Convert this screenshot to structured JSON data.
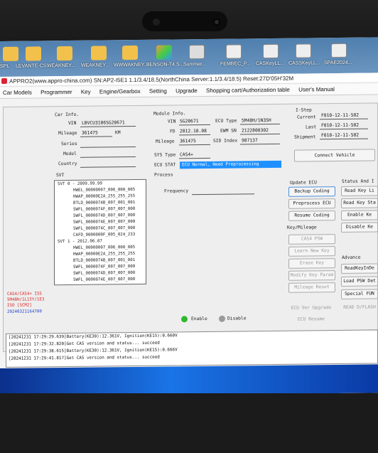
{
  "taskbar": {
    "items": [
      "SPL",
      "LEVANTE-CS...",
      "WEAKNEY...",
      "WEAKNEY...",
      "WWWAKNEY...",
      "BENSON-T4.S...",
      "Summer...",
      "FEMBEC_P...",
      "CASKeyLL...",
      "CASSKeyLL...",
      "SPAE2024..."
    ]
  },
  "title_bar": {
    "text": "APPRO2(www.appro-china.com) SN:AP2-I5E1 1.1/3.4/18.5(NorthChina Server:1.1/3.4/18.5) Reset:27D'05H'32M"
  },
  "menu": [
    "Car Models",
    "Programmer",
    "Key",
    "Engine/Gearbox",
    "Setting",
    "Upgrade",
    "Shopping cart/Authorization table",
    "User's Manual"
  ],
  "car_info": {
    "heading": "Car Info.",
    "vin_label": "VIN",
    "vin": "LBVCU3106SG20671",
    "mileage_label": "Mileage",
    "mileage": "361475",
    "mileage_unit": "KM",
    "series_label": "Series",
    "model_label": "Model",
    "country_label": "Country"
  },
  "module_info": {
    "heading": "Module Info.",
    "vin_label": "VIN",
    "vin": "SG20671",
    "fd_label": "FD",
    "fd": "2012.10.08",
    "mileage_label": "Mileage",
    "mileage": "361475",
    "ecu_type_label": "ECU Type",
    "ecu_type": "5M48H/1N35H",
    "ewm_sn_label": "EWM SN",
    "ewm_sn": "2122800302",
    "sid_label": "SID Index",
    "sid": "987137",
    "sys_type_label": "SYS Type",
    "sys_type": "CAS4+",
    "ecu_stat_label": "ECU STAT",
    "ecu_stat": "ECU Normal, Need Preprocessing"
  },
  "istep": {
    "heading": "I-Step",
    "current_label": "Current",
    "current": "F010-12-11-502",
    "last_label": "Last",
    "last": "F010-12-11-502",
    "shipment_label": "Shipment",
    "shipment": "F010-12-11-502"
  },
  "connect_button": "Connect Vehicle",
  "svt": {
    "heading": "SVT",
    "group0": "SVT 0 - 2099.99.99",
    "group0_items": [
      "HWEL_00000007_006_000_005",
      "HWAP_00000E2A_255_255_255",
      "BTLD_0000074B_007_001_001",
      "SWFL_0000074F_007_007_000",
      "SWFL_0000074D_007_007_000",
      "SWFL_0000074E_007_007_000",
      "SWFL_0000074C_007_007_000",
      "CAFD_0000000F_005_024_233"
    ],
    "group1": "SVT 1 - 2012.06.07",
    "group1_items": [
      "HWEL_00000007_006_000_005",
      "HWAP_00000E2A_255_255_255",
      "BTLD_0000074B_007_001_001",
      "SWFL_0000074F_007_007_000",
      "SWFL_0000074D_007_007_000",
      "SWFL_0000074E_007_007_000",
      "SWFL_0000074C_007_007_000"
    ]
  },
  "process": {
    "heading": "Process",
    "frequency_label": "Frequency"
  },
  "side_info": {
    "red_lines": [
      "CAS4/CAS4+ ISS",
      "5M48H/1L15Y/1E3",
      "ISO [SCM2]"
    ],
    "blue_line": "20240321164700"
  },
  "status": {
    "enable": "Enable",
    "disable": "Disable",
    "enable_color": "#2db82d",
    "disable_color": "#9a9a9a"
  },
  "update_ecu": {
    "heading": "Update ECU",
    "buttons": [
      "Backup Coding",
      "Preprocess ECU",
      "Resume Coding"
    ]
  },
  "key_mileage": {
    "heading": "Key/Mileage",
    "buttons": [
      "CAS4 PSW",
      "Learn New Key",
      "Erase Key",
      "Modify Key Param",
      "Mileage Reset"
    ],
    "ecu_ver_upgrade": "ECU Ver Upgrade",
    "ecu_resume": "ECU Resume"
  },
  "status_info": {
    "heading": "Status And I",
    "buttons": [
      "Read Key Li",
      "Read Key Sta",
      "Enable Ke",
      "Disable Ke"
    ]
  },
  "advance": {
    "heading": "Advance",
    "buttons": [
      "ReadKeyInDe",
      "Load PSW Dat",
      "Special FUN"
    ],
    "read_d_flash": "READ D/FLASH"
  },
  "log": [
    "[20241231 17:29:29.639]Battery(KE30):12.361V, Ignition(KE15):0.660V",
    "[20241231 17:29:32.820]Get CAS version and status... succeed",
    "[20241231 17:29:38.615]Battery(KE30):12.361V, Ignition(KE15):0.666V",
    "[20241231 17:29:41.817]Get CAS version and status... succeed"
  ]
}
